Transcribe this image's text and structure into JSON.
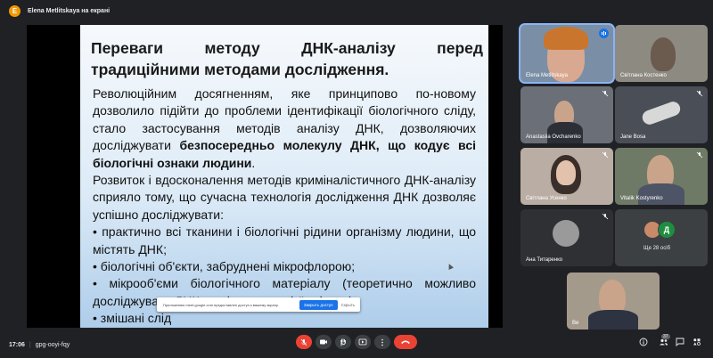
{
  "presenter": {
    "initial": "E",
    "label": "Elena Metlitskaya на екрані"
  },
  "slide": {
    "title_line1_words": [
      "Переваги",
      "методу",
      "ДНК-аналізу",
      "перед"
    ],
    "title_line2": "традиційними методами дослідження.",
    "p1_start": "Революційним досягненням, яке принципово по-новому дозволило підійти до проблеми ідентифікації біологічного сліду, стало застосування методів аналізу ДНК, дозволяючих досліджувати ",
    "p1_bold": "безпосередньо молекулу ДНК, що кодує всі біологічні ознаки людини",
    "p1_end": ".",
    "p2": "Розвиток і вдосконалення методів криміналістичного ДНК-аналізу сприяло тому, що сучасна технологія дослідження ДНК дозволяє успішно досліджувати:",
    "b1": "• практично всі тканини і біологічні рідини організму людини, що містять ДНК;",
    "b2": "• біологічні об'єкти, забруднені мікрофлорою;",
    "b3": "•  мікрооб'єми біологічного матеріалу (теоретично можливо досліджувати ДНК, виділену з однієї клітини);",
    "b4": "• змішані слід"
  },
  "permission_bar": {
    "text": "Приложению meet.google.com предоставлен доступ к вашему экрану.",
    "allow": "Закрыть доступ",
    "hide": "Скрыть"
  },
  "participants": [
    {
      "name": "Elena Metlitskaya"
    },
    {
      "name": "Світлана Костенко"
    },
    {
      "name": "Anastasiia Ovcharenko"
    },
    {
      "name": "Jane Bosa"
    },
    {
      "name": "Світлана Усенко"
    },
    {
      "name": "Vitalik Kostyrenko"
    },
    {
      "name": "Ана Титаренко"
    },
    {
      "name": "Ви"
    }
  ],
  "more": {
    "label": "Ще 28 осіб",
    "avatar_letter": "Д"
  },
  "bottom": {
    "time": "17:06",
    "separator": "|",
    "meeting_code": "gpg-ooyi-fqy",
    "participant_count": "37"
  },
  "icons": {
    "mic_off": "mic-off-icon",
    "camera": "camera-icon",
    "raise_hand": "raise-hand-icon",
    "present": "present-icon",
    "more": "more-vert-icon",
    "end_call": "end-call-icon",
    "info": "info-icon",
    "people": "people-icon",
    "chat": "chat-icon",
    "activities": "activities-icon"
  },
  "colors": {
    "accent": "#1a73e8",
    "end_call": "#ea4335",
    "presenter": "#f29900",
    "background": "#202124"
  }
}
